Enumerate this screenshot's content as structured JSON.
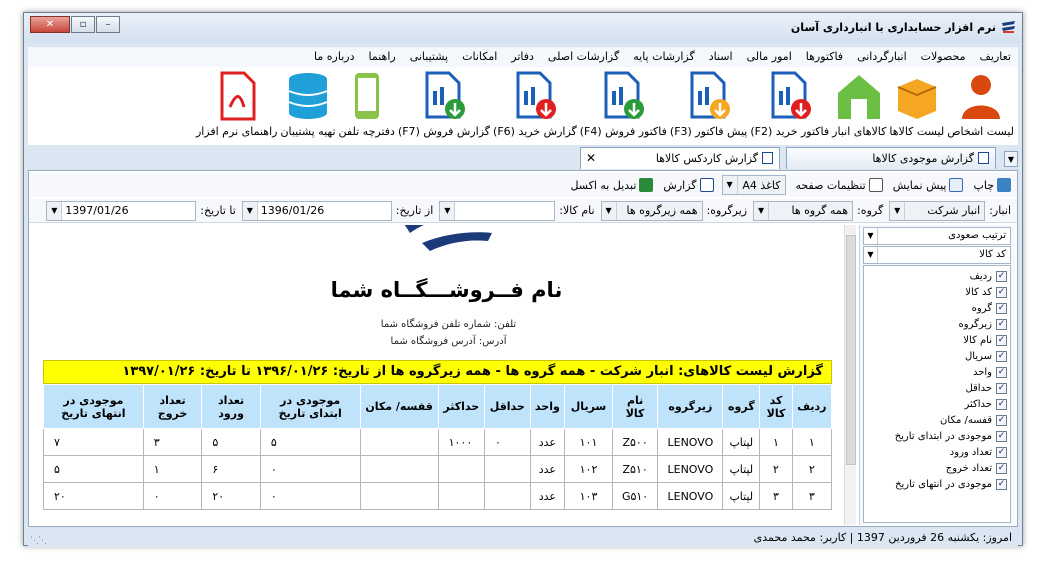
{
  "window": {
    "title": "نرم افزار حسابداری با انبارداری آسان"
  },
  "menu": [
    "تعاریف",
    "محصولات",
    "انبارگردانی",
    "فاکتورها",
    "امور مالی",
    "اسناد",
    "گزارشات پایه",
    "گزارشات اصلی",
    "دفاتر",
    "امکانات",
    "پشتیبانی",
    "راهنما",
    "درباره ما"
  ],
  "ribbon": [
    {
      "label": "لیست اشخاص",
      "icon": "person-icon",
      "color": "#d9480f"
    },
    {
      "label": "لیست کالاها",
      "icon": "box-icon",
      "color": "#f5a623"
    },
    {
      "label": "کالاهای انبار",
      "icon": "warehouse-icon",
      "color": "#6cbf45"
    },
    {
      "label": "فاکتور خرید (F2)",
      "icon": "purchase-invoice-icon",
      "color": "#e02020"
    },
    {
      "label": "پیش فاکتور (F3)",
      "icon": "proforma-icon",
      "color": "#f5a623"
    },
    {
      "label": "فاکتور فروش (F4)",
      "icon": "sales-invoice-icon",
      "color": "#2a9a3a"
    },
    {
      "label": "گزارش خرید (F6)",
      "icon": "purchase-report-icon",
      "color": "#e02020"
    },
    {
      "label": "گزارش فروش (F7)",
      "icon": "sales-report-icon",
      "color": "#2a9a3a"
    },
    {
      "label": "دفترچه تلفن",
      "icon": "phone-icon",
      "color": "#8bc34a"
    },
    {
      "label": "تهیه پشتیبان",
      "icon": "database-icon",
      "color": "#1fa0d8"
    },
    {
      "label": "راهنمای نرم افزار",
      "icon": "pdf-icon",
      "color": "#e02020"
    }
  ],
  "tabs": {
    "tab1": "گزارش موجودی کالاها",
    "tab2": "گزارش کاردکس کالاها"
  },
  "toolbar": {
    "print": "چاپ",
    "preview": "پیش نمایش",
    "page_settings": "تنظیمات صفحه",
    "paper": "کاغذ A4",
    "report": "گزارش",
    "excel": "تبدیل به اکسل"
  },
  "filters": {
    "warehouse_label": "انبار:",
    "warehouse": "انبار شرکت",
    "group_label": "گروه:",
    "group": "همه گروه ها",
    "subgroup_label": "زیرگروه:",
    "subgroup": "همه زیرگروه ها",
    "product_label": "نام کالا:",
    "product": "",
    "from_label": "از تاریخ:",
    "from": "1396/01/26",
    "to_label": "تا تاریخ:",
    "to": "1397/01/26"
  },
  "report": {
    "shop_name": "نام فــروشـــگــاه شما",
    "phone": "تلفن: شماره تلفن فروشگاه شما",
    "address": "آدرس: آدرس فروشگاه شما",
    "banner": "گزارش لیست کالاهای: انبار شرکت - همه گروه ها - همه زیرگروه ها از تاریخ: ۱۳۹۶/۰۱/۲۶ تا تاریخ: ۱۳۹۷/۰۱/۲۶",
    "columns": [
      "ردیف",
      "کد کالا",
      "گروه",
      "زیرگروه",
      "نام کالا",
      "سریال",
      "واحد",
      "حداقل",
      "حداکثر",
      "قفسه/ مکان",
      "موجودی در ابتدای تاریخ",
      "تعداد ورود",
      "تعداد خروج",
      "موجودی در انتهای تاریخ"
    ],
    "rows": [
      [
        "۱",
        "۱",
        "لپتاپ",
        "LENOVO",
        "Z۵۰۰",
        "۱۰۱",
        "عدد",
        "۰",
        "۱۰۰۰",
        "",
        "۵",
        "۵",
        "۳",
        "۷"
      ],
      [
        "۲",
        "۲",
        "لپتاپ",
        "LENOVO",
        "Z۵۱۰",
        "۱۰۲",
        "عدد",
        "",
        "",
        "",
        "۰",
        "۶",
        "۱",
        "۵"
      ],
      [
        "۳",
        "۳",
        "لپتاپ",
        "LENOVO",
        "G۵۱۰",
        "۱۰۳",
        "عدد",
        "",
        "",
        "",
        "۰",
        "۲۰",
        "۰",
        "۲۰"
      ]
    ]
  },
  "panel": {
    "sort": "ترتیب صعودی",
    "sortby": "کد کالا",
    "fields": [
      "ردیف",
      "کد کالا",
      "گروه",
      "زیرگروه",
      "نام کالا",
      "سریال",
      "واحد",
      "حداقل",
      "حداکثر",
      "قفسه/ مکان",
      "موجودی در ابتدای تاریخ",
      "تعداد ورود",
      "تعداد خروج",
      "موجودی در انتهای تاریخ"
    ]
  },
  "status": {
    "text": "امروز: یکشنبه 26 فروردین 1397   |   کاربر: محمد محمدی"
  }
}
